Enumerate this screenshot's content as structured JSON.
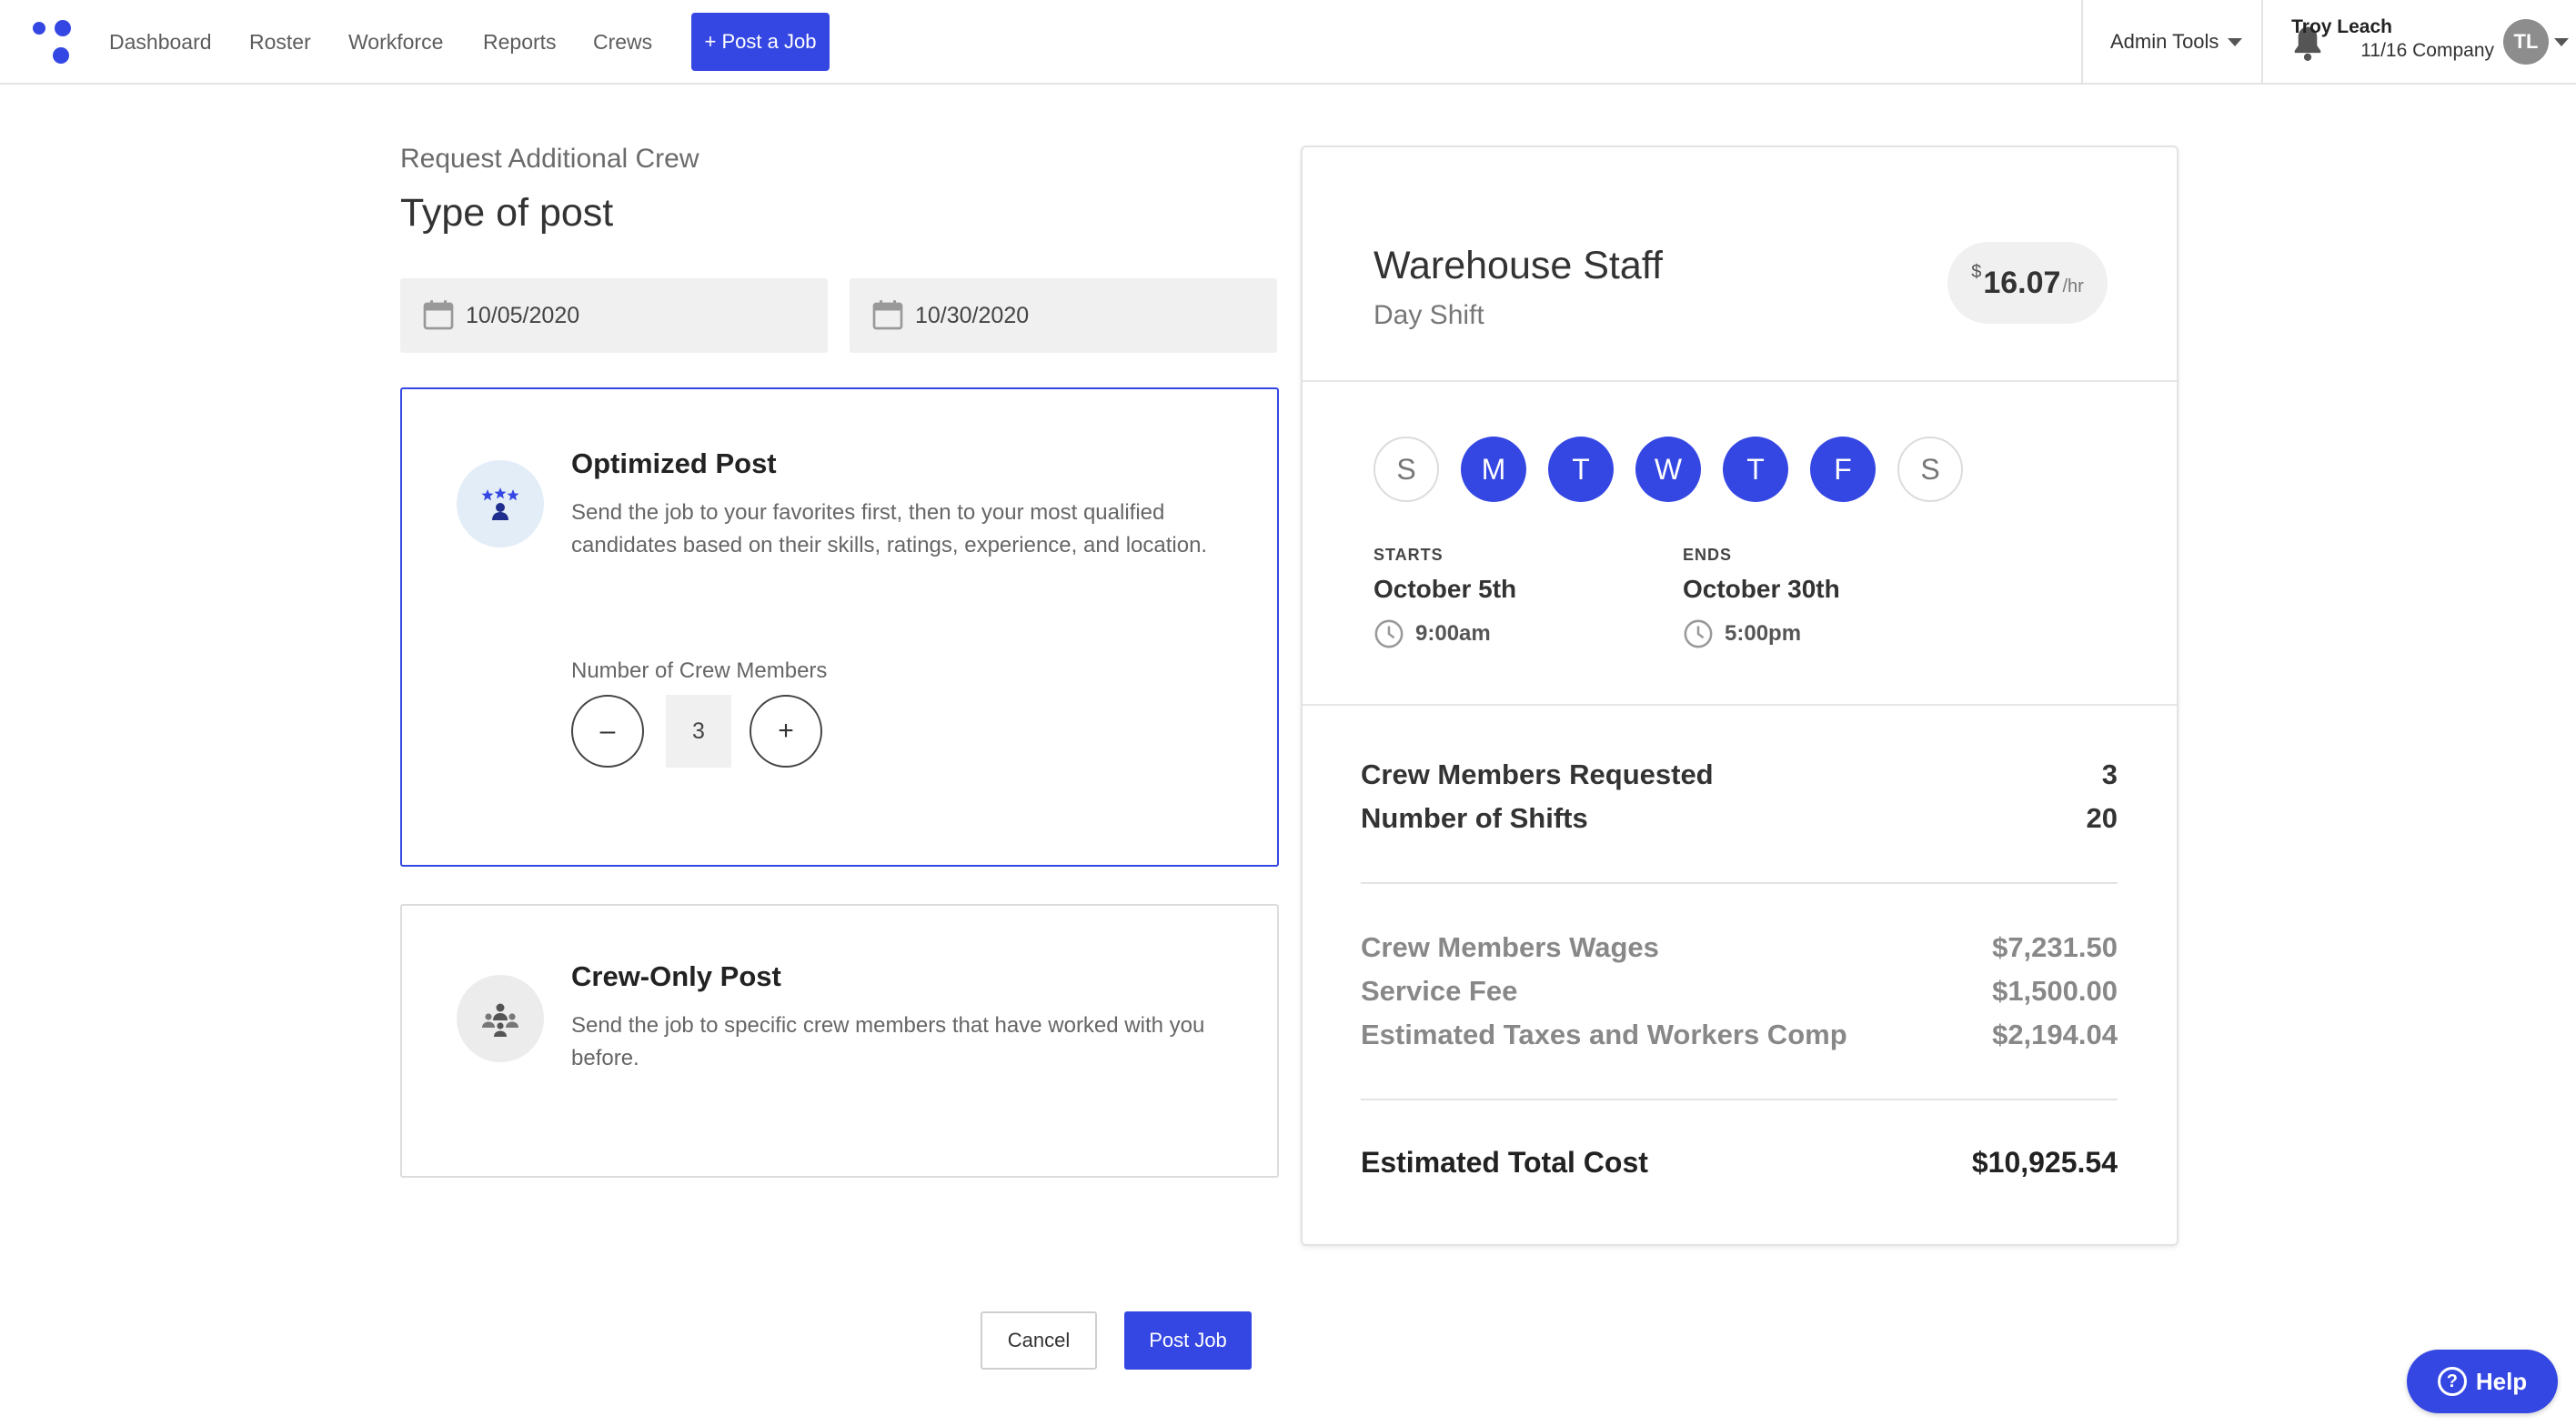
{
  "nav": {
    "links": [
      "Dashboard",
      "Roster",
      "Workforce",
      "Reports",
      "Crews"
    ],
    "post_job_label": "+ Post a Job",
    "admin_tools_label": "Admin Tools",
    "user_name": "Troy Leach",
    "company": "11/16 Company",
    "avatar_initials": "TL"
  },
  "form": {
    "subtitle": "Request Additional Crew",
    "title": "Type of post",
    "start_date": "10/05/2020",
    "end_date": "10/30/2020"
  },
  "options": {
    "optimized": {
      "title": "Optimized Post",
      "description": "Send the job to your favorites first, then to your most qualified candidates based on their skills, ratings, experience, and location.",
      "crew_label": "Number of Crew Members",
      "crew_count": "3",
      "minus": "–",
      "plus": "+"
    },
    "crew_only": {
      "title": "Crew-Only Post",
      "description": "Send the job to specific crew members that have worked with you before."
    }
  },
  "summary": {
    "job_title": "Warehouse Staff",
    "shift": "Day Shift",
    "rate_currency": "$",
    "rate_amount": "16.07",
    "rate_unit": "/hr",
    "days": [
      {
        "label": "S",
        "active": false
      },
      {
        "label": "M",
        "active": true
      },
      {
        "label": "T",
        "active": true
      },
      {
        "label": "W",
        "active": true
      },
      {
        "label": "T",
        "active": true
      },
      {
        "label": "F",
        "active": true
      },
      {
        "label": "S",
        "active": false
      }
    ],
    "starts_label": "STARTS",
    "starts_date": "October 5th",
    "starts_time": "9:00am",
    "ends_label": "ENDS",
    "ends_date": "October 30th",
    "ends_time": "5:00pm",
    "crew_requested_label": "Crew Members Requested",
    "crew_requested_value": "3",
    "shifts_label": "Number of Shifts",
    "shifts_value": "20",
    "wages_label": "Crew Members Wages",
    "wages_value": "$7,231.50",
    "fee_label": "Service Fee",
    "fee_value": "$1,500.00",
    "taxes_label": "Estimated Taxes and Workers Comp",
    "taxes_value": "$2,194.04",
    "total_label": "Estimated Total Cost",
    "total_value": "$10,925.54"
  },
  "actions": {
    "cancel_label": "Cancel",
    "post_label": "Post Job",
    "help_label": "Help",
    "help_glyph": "?"
  },
  "colors": {
    "accent": "#3547e3",
    "muted_text": "#888888",
    "field_bg": "#f0f0f0"
  }
}
